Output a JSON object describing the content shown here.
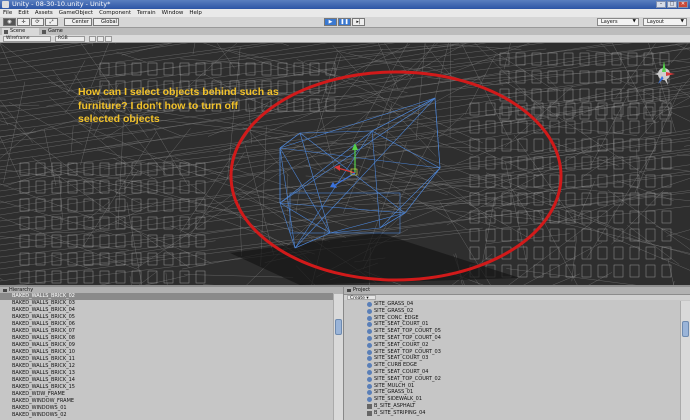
{
  "window": {
    "title": "Unity - 08-30-10.unity - Unity*"
  },
  "menu": [
    "File",
    "Edit",
    "Assets",
    "GameObject",
    "Component",
    "Terrain",
    "Window",
    "Help"
  ],
  "toolbar": {
    "pivot_label": "Center",
    "space_label": "Global",
    "layers_label": "Layers",
    "layout_label": "Layout"
  },
  "scene_tabs": {
    "scene": "Scene",
    "game": "Game"
  },
  "scene_bar": {
    "render_mode": "Wireframe",
    "color_mode": "RGB"
  },
  "annotation": {
    "line1": "How can I select objects behind such as",
    "line2": "furniture?  I don't how to turn off",
    "line3": "selected objects",
    "color": "#f2c22a"
  },
  "accent": {
    "circle": "#d11a1a",
    "selection": "#4d86d8"
  },
  "hierarchy": {
    "title": "Hierarchy",
    "create_label": "",
    "items": [
      "BAKED_WALLS_BRICK_02",
      "BAKED_WALLS_BRICK_03",
      "BAKED_WALLS_BRICK_04",
      "BAKED_WALLS_BRICK_05",
      "BAKED_WALLS_BRICK_06",
      "BAKED_WALLS_BRICK_07",
      "BAKED_WALLS_BRICK_08",
      "BAKED_WALLS_BRICK_09",
      "BAKED_WALLS_BRICK_10",
      "BAKED_WALLS_BRICK_11",
      "BAKED_WALLS_BRICK_12",
      "BAKED_WALLS_BRICK_13",
      "BAKED_WALLS_BRICK_14",
      "BAKED_WALLS_BRICK_15",
      "BAKED_WDW_FRAME",
      "BAKED_WINDOW_FRAME",
      "BAKED_WINDOWS_01",
      "BAKED_WINDOWS_02"
    ]
  },
  "project": {
    "title": "Project",
    "create_label": "Create",
    "items": [
      "SITE_GRASS_04",
      "SITE_GRASS_02",
      "SITE_CONC_EDGE",
      "SITE_SEAT_COURT_01",
      "SITE_SEAT_TOP_COURT_05",
      "SITE_SEAT_TOP_COURT_04",
      "SITE_SEAT_COURT_02",
      "SITE_SEAT_TOP_COURT_03",
      "SITE_SEAT_COURT_03",
      "SITE_CURB EDGE",
      "SITE_SEAT_COURT_04",
      "SITE_SEAT_TOP_COURT_02",
      "SITE_MULCH_01",
      "SITE_GRASS_01",
      "SITE_SIDEWALK_01",
      "B_SITE_ASPHALT",
      "B_SITE_STRIPING_04"
    ]
  }
}
